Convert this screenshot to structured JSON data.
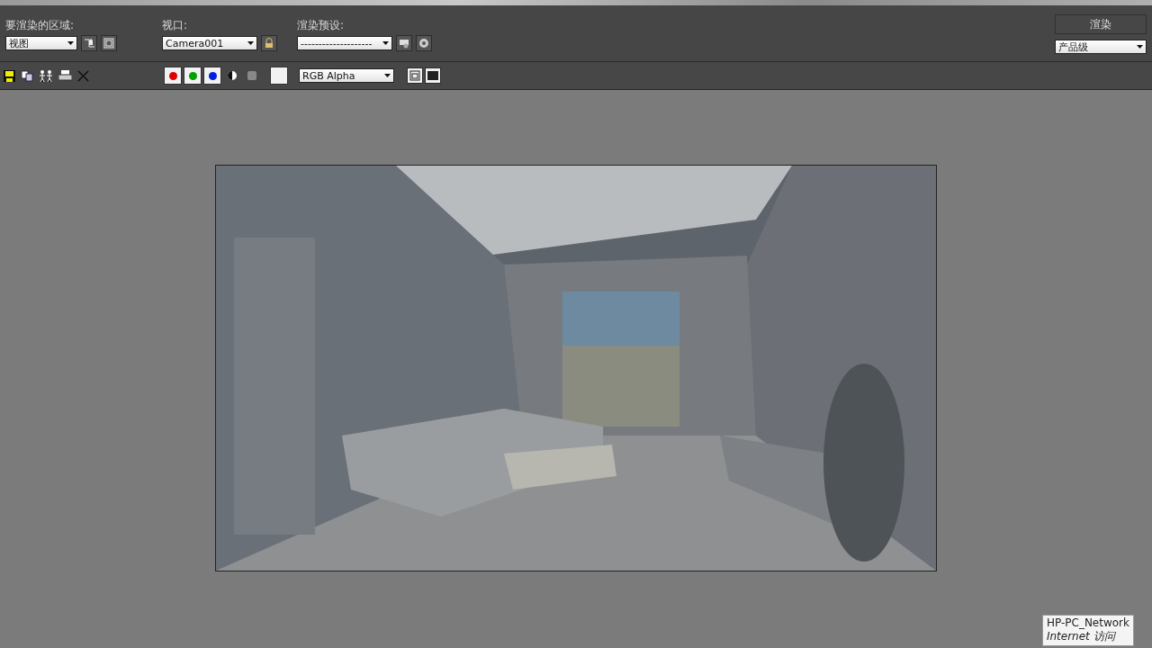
{
  "top_panel": {
    "area": {
      "label": "要渲染的区域:",
      "value": "视图"
    },
    "viewport": {
      "label": "视口:",
      "value": "Camera001",
      "locked": true
    },
    "preset": {
      "label": "渲染预设:",
      "value": "--------------------"
    },
    "render_button": "渲染",
    "quality": {
      "value": "产品级"
    }
  },
  "toolbar": {
    "channels": [
      {
        "color": "#e00000",
        "on": true
      },
      {
        "color": "#00a000",
        "on": true
      },
      {
        "color": "#0020e0",
        "on": true
      }
    ],
    "channel_display": {
      "value": "RGB Alpha"
    }
  },
  "network_tooltip": {
    "title": "HP-PC_Network",
    "status": "Internet 访问"
  }
}
